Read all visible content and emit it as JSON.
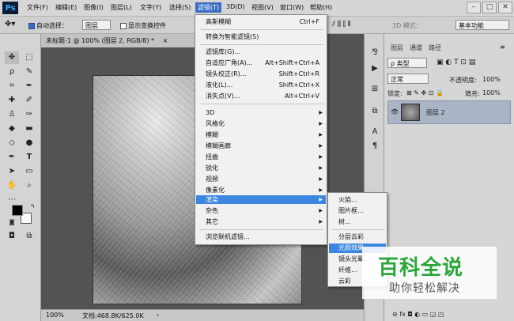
{
  "app": {
    "logo": "Ps"
  },
  "menubar": [
    "文件(F)",
    "编辑(E)",
    "图像(I)",
    "图层(L)",
    "文字(Y)",
    "选择(S)",
    "滤镜(T)",
    "3D(D)",
    "视图(V)",
    "窗口(W)",
    "帮助(H)"
  ],
  "window_controls": [
    "–",
    "□",
    "✕"
  ],
  "options": {
    "auto_select": "自动选择：",
    "auto_select_value": "图层",
    "show_transform": "显示变换控件",
    "mode_3d": "3D 模式：",
    "workspace": "基本功能"
  },
  "document": {
    "tab": "未标题-1 @ 100% (图层 2, RGB/8) *",
    "close": "×",
    "zoom": "100%",
    "doc_info": "文档:468.8K/625.0K"
  },
  "filter_menu": {
    "items": [
      {
        "label": "高斯模糊",
        "shortcut": "Ctrl+F"
      },
      {
        "label": "转换为智能滤镜(S)"
      },
      {
        "label": "滤镜库(G)..."
      },
      {
        "label": "自适应广角(A)...",
        "shortcut": "Alt+Shift+Ctrl+A"
      },
      {
        "label": "镜头校正(R)...",
        "shortcut": "Shift+Ctrl+R"
      },
      {
        "label": "液化(L)...",
        "shortcut": "Shift+Ctrl+X"
      },
      {
        "label": "消失点(V)...",
        "shortcut": "Alt+Ctrl+V"
      },
      {
        "label": "3D"
      },
      {
        "label": "风格化"
      },
      {
        "label": "模糊"
      },
      {
        "label": "模糊画廊"
      },
      {
        "label": "扭曲"
      },
      {
        "label": "锐化"
      },
      {
        "label": "视频"
      },
      {
        "label": "像素化"
      },
      {
        "label": "渲染"
      },
      {
        "label": "杂色"
      },
      {
        "label": "其它"
      },
      {
        "label": "浏览联机滤镜..."
      }
    ],
    "arrow": "▶"
  },
  "render_submenu": [
    "火焰...",
    "图片框...",
    "树...",
    "分层云彩",
    "光照效果...",
    "镜头光晕...",
    "纤维...",
    "云彩"
  ],
  "layers_panel": {
    "tabs": [
      "图层",
      "通道",
      "路径"
    ],
    "kind_filter": "ρ 类型",
    "blend_mode": "正常",
    "opacity_label": "不透明度:",
    "opacity_value": "100%",
    "lock_label": "锁定:",
    "fill_label": "填充:",
    "fill_value": "100%",
    "layer_name": "图层 2",
    "footer_icons": "⊖ fx ◘ ◐ ▭ ◲ ◳"
  },
  "watermark": {
    "title": "百科全说",
    "subtitle": "助你轻松解决"
  }
}
